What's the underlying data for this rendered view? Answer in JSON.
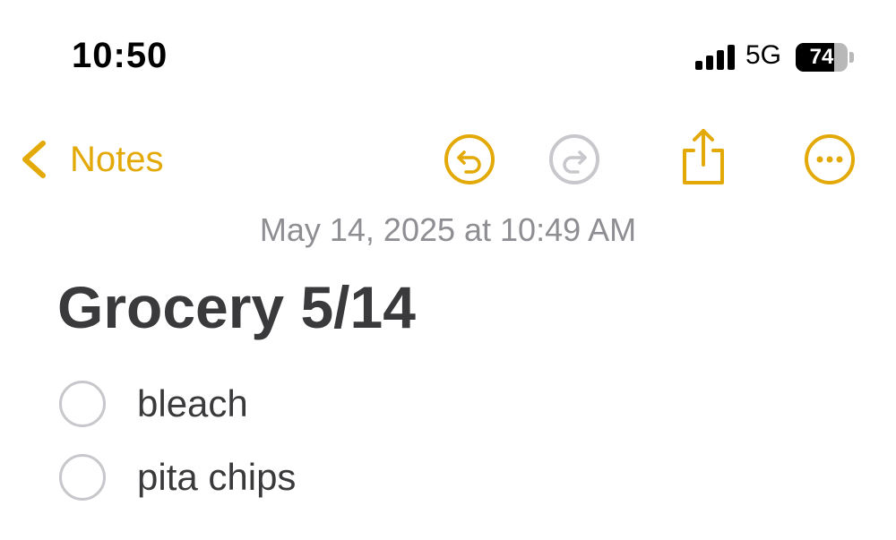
{
  "status_bar": {
    "time": "10:50",
    "network": "5G",
    "battery_level": "74",
    "battery_fraction": 0.74
  },
  "toolbar": {
    "back_label": "Notes",
    "accent_color": "#E3A907",
    "disabled_color": "#C7C7CC",
    "icons": [
      "chevron-left-icon",
      "undo-icon",
      "redo-icon",
      "share-icon",
      "more-icon"
    ]
  },
  "note": {
    "timestamp": "May 14, 2025 at 10:49 AM",
    "title": "Grocery 5/14",
    "items": [
      {
        "text": "bleach",
        "checked": false
      },
      {
        "text": "pita chips",
        "checked": false
      }
    ]
  }
}
